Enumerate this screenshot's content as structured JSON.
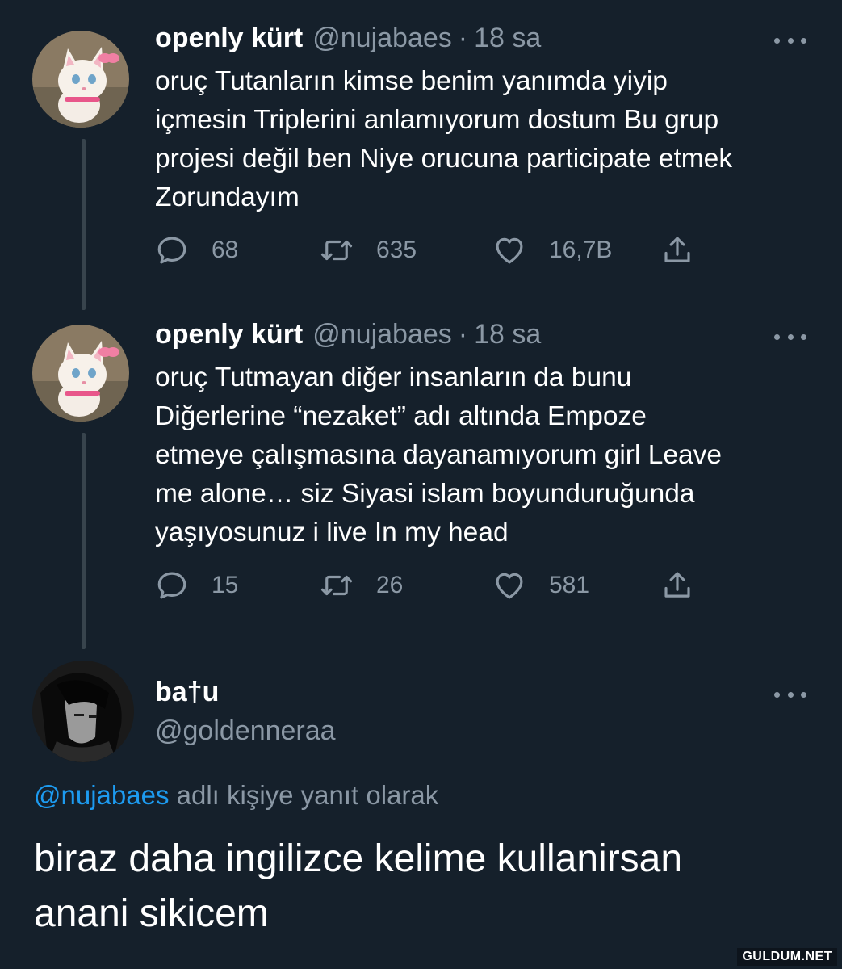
{
  "tweets": [
    {
      "name": "openly kürt",
      "handle": "@nujabaes",
      "separator": "·",
      "time": "18 sa",
      "lines": [
        "oruç Tutanların kimse benim yanımda yiyip",
        "içmesin Triplerini anlamıyorum dostum Bu grup",
        "projesi değil ben Niye orucuna participate etmek",
        "Zorundayım"
      ],
      "replies": "68",
      "retweets": "635",
      "likes": "16,7B"
    },
    {
      "name": "openly kürt",
      "handle": "@nujabaes",
      "separator": "·",
      "time": "18 sa",
      "lines": [
        "oruç Tutmayan diğer insanların da bunu",
        "Diğerlerine “nezaket” adı altında Empoze",
        "etmeye çalışmasına dayanamıyorum girl Leave",
        "me alone… siz Siyasi islam boyunduruğunda",
        "yaşıyosunuz i live In my head"
      ],
      "replies": "15",
      "retweets": "26",
      "likes": "581"
    }
  ],
  "reply": {
    "name": "ba†u",
    "handle": "@goldenneraa",
    "reply_to_handle": "@nujabaes",
    "reply_to_text": " adlı kişiye yanıt olarak",
    "lines": [
      "biraz daha ingilizce kelime kullanirsan",
      "anani sikicem"
    ]
  },
  "watermark": "GULDUM.NET",
  "icons": [
    "more-icon",
    "reply-icon",
    "retweet-icon",
    "like-icon",
    "share-icon"
  ],
  "colors": {
    "background": "#15202b",
    "text": "#ffffff",
    "secondary": "#8b98a5",
    "link": "#1d9bf0",
    "thread_line": "#38444d"
  }
}
